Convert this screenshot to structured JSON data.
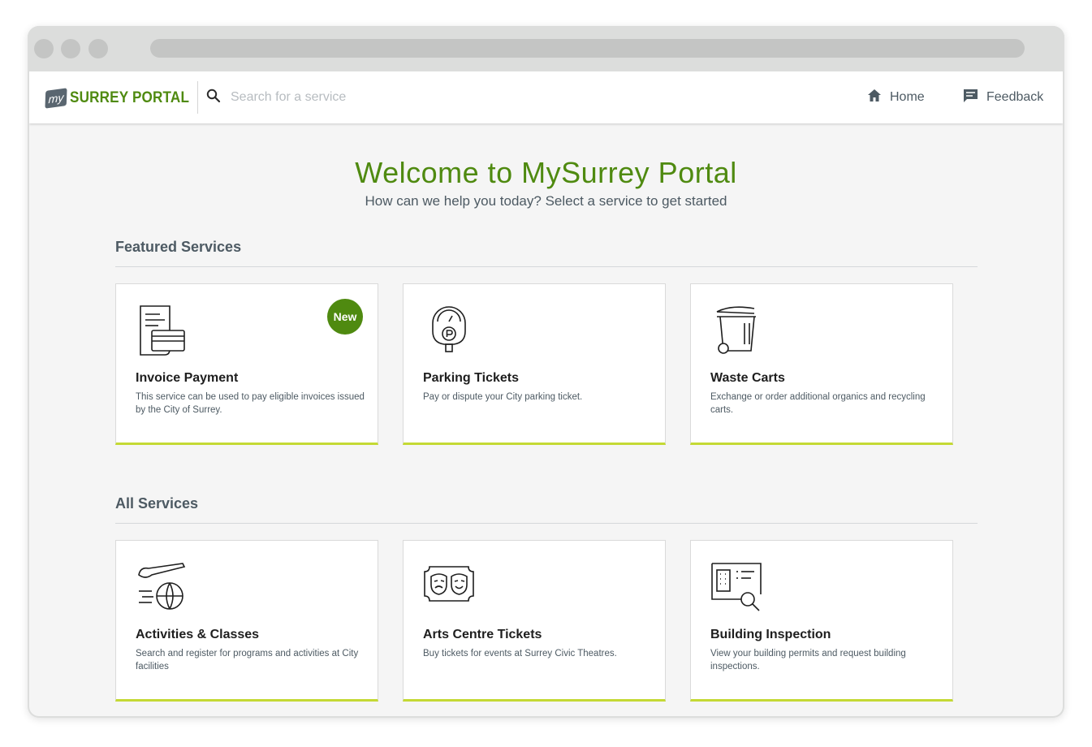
{
  "header": {
    "logo_badge": "my",
    "logo_text": "SURREY PORTAL",
    "search_placeholder": "Search for a service",
    "nav": {
      "home": "Home",
      "feedback": "Feedback"
    }
  },
  "hero": {
    "title": "Welcome to MySurrey Portal",
    "subtitle": "How can we help you today? Select a service to get started"
  },
  "featured": {
    "heading": "Featured Services",
    "cards": [
      {
        "title": "Invoice Payment",
        "desc": "This service can be used to pay eligible invoices issued by the City of Surrey.",
        "badge": "New",
        "icon": "invoice-icon"
      },
      {
        "title": "Parking Tickets",
        "desc": "Pay or dispute your City parking ticket.",
        "icon": "parking-meter-icon"
      },
      {
        "title": "Waste Carts",
        "desc": "Exchange or order additional organics and recycling carts.",
        "icon": "waste-cart-icon"
      }
    ]
  },
  "all": {
    "heading": "All Services",
    "cards": [
      {
        "title": "Activities & Classes",
        "desc": "Search and register for programs and activities at City facilities",
        "icon": "activities-icon"
      },
      {
        "title": "Arts Centre Tickets",
        "desc": "Buy tickets for events at Surrey Civic Theatres.",
        "icon": "theatre-masks-icon"
      },
      {
        "title": "Building Inspection",
        "desc": "View your building permits and request building inspections.",
        "icon": "building-inspection-icon"
      }
    ]
  },
  "colors": {
    "brand_green": "#4f8a10",
    "accent_lime": "#c4d934",
    "text_gray": "#4d5a63"
  }
}
